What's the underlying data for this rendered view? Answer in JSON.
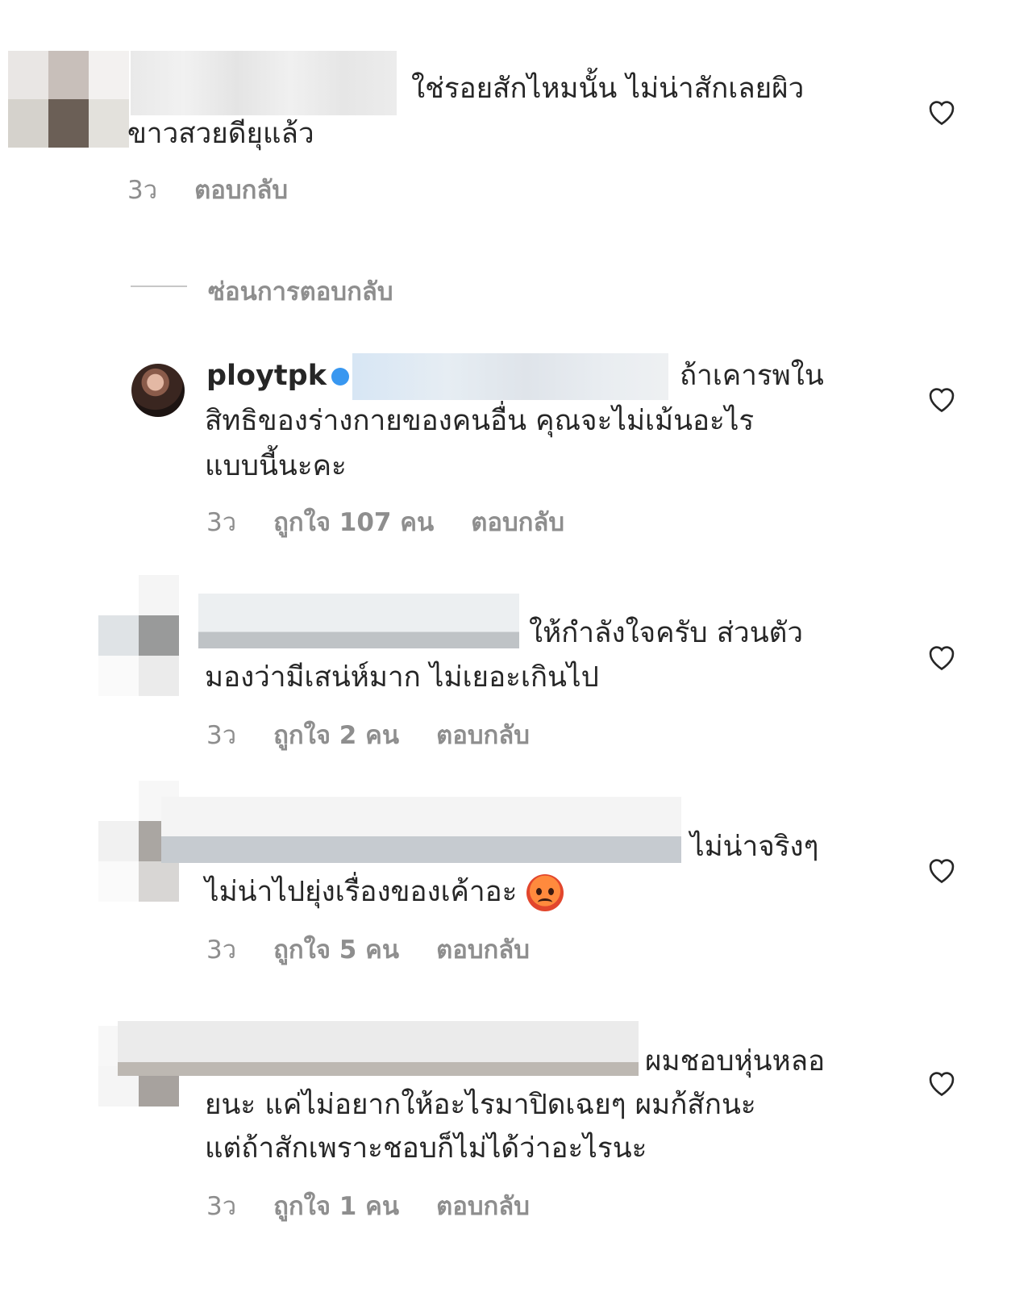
{
  "comments": [
    {
      "text_line1": "ใช่รอยสักไหมนั้น ไม่น่าสักเลยผิว",
      "text_line2": "ขาวสวยดียุแล้ว",
      "time": "3ว",
      "reply": "ตอบกลับ"
    },
    {
      "username": "ploytpk",
      "text_line1": "ถ้าเคารพใน",
      "text_line2": "สิทธิของร่างกายของคนอื่น คุณจะไม่เม้นอะไร",
      "text_line3": "แบบนี้นะคะ",
      "time": "3ว",
      "likes": "ถูกใจ 107 คน",
      "reply": "ตอบกลับ"
    },
    {
      "text_line1": "ให้กำลังใจครับ ส่วนตัว",
      "text_line2": "มองว่ามีเสน่ห์มาก ไม่เยอะเกินไป",
      "time": "3ว",
      "likes": "ถูกใจ 2 คน",
      "reply": "ตอบกลับ"
    },
    {
      "text_line1": "ไม่น่าจริงๆ",
      "text_line2": "ไม่น่าไปยุ่งเรื่องของเค้าอะ",
      "time": "3ว",
      "likes": "ถูกใจ 5 คน",
      "reply": "ตอบกลับ"
    },
    {
      "text_line1": "ผมชอบหุ่นหลอ",
      "text_line2": "ยนะ แค่ไม่อยากให้อะไรมาปิดเฉยๆ ผมก้สักนะ",
      "text_line3": "แต่ถ้าสักเพราะชอบก็ไม่ได้ว่าอะไรนะ",
      "time": "3ว",
      "likes": "ถูกใจ 1 คน",
      "reply": "ตอบกลับ"
    }
  ],
  "hide_replies": "ซ่อนการตอบกลับ",
  "icons": {
    "like": "heart-outline-icon",
    "emoji": "angry-face-emoji"
  }
}
